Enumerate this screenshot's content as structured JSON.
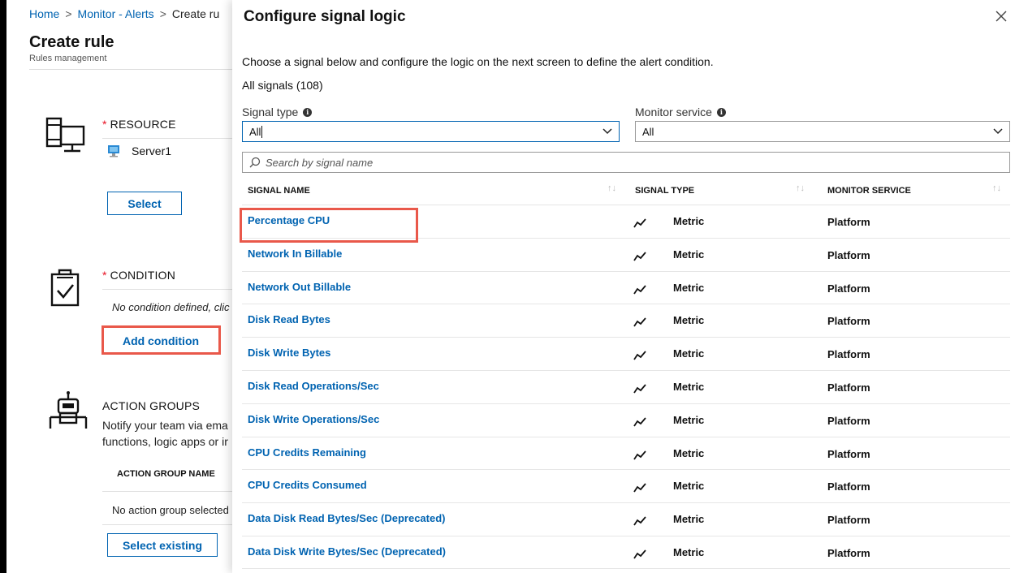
{
  "breadcrumb": {
    "home": "Home",
    "alerts": "Monitor - Alerts",
    "current": "Create ru"
  },
  "left": {
    "title": "Create rule",
    "subtitle": "Rules management",
    "resource": {
      "title": "RESOURCE",
      "required_marker": "*",
      "server_name": "Server1",
      "select_button": "Select"
    },
    "condition": {
      "title": "CONDITION",
      "required_marker": "*",
      "empty_text": "No condition defined, clic",
      "add_button": "Add condition"
    },
    "action_groups": {
      "title": "ACTION GROUPS",
      "desc_line1": "Notify your team via ema",
      "desc_line2": "functions, logic apps or ir",
      "column_header": "ACTION GROUP NAME",
      "empty_text": "No action group selected",
      "select_button": "Select existing"
    }
  },
  "panel": {
    "title": "Configure signal logic",
    "close_label": "×",
    "instruction": "Choose a signal below and configure the logic on the next screen to define the alert condition.",
    "all_signals": "All signals (108)",
    "signal_type": {
      "label": "Signal type",
      "value": "All"
    },
    "monitor_service": {
      "label": "Monitor service",
      "value": "All"
    },
    "search": {
      "placeholder": "Search by signal name"
    },
    "columns": {
      "signal_name": "SIGNAL NAME",
      "signal_type": "SIGNAL TYPE",
      "monitor_service": "MONITOR SERVICE",
      "sort_glyph": "↑↓"
    },
    "signals": [
      {
        "name": "Percentage CPU",
        "type": "Metric",
        "service": "Platform"
      },
      {
        "name": "Network In Billable",
        "type": "Metric",
        "service": "Platform"
      },
      {
        "name": "Network Out Billable",
        "type": "Metric",
        "service": "Platform"
      },
      {
        "name": "Disk Read Bytes",
        "type": "Metric",
        "service": "Platform"
      },
      {
        "name": "Disk Write Bytes",
        "type": "Metric",
        "service": "Platform"
      },
      {
        "name": "Disk Read Operations/Sec",
        "type": "Metric",
        "service": "Platform"
      },
      {
        "name": "Disk Write Operations/Sec",
        "type": "Metric",
        "service": "Platform"
      },
      {
        "name": "CPU Credits Remaining",
        "type": "Metric",
        "service": "Platform"
      },
      {
        "name": "CPU Credits Consumed",
        "type": "Metric",
        "service": "Platform"
      },
      {
        "name": "Data Disk Read Bytes/Sec (Deprecated)",
        "type": "Metric",
        "service": "Platform"
      },
      {
        "name": "Data Disk Write Bytes/Sec (Deprecated)",
        "type": "Metric",
        "service": "Platform"
      }
    ]
  },
  "colors": {
    "link_blue": "#0063b1",
    "highlight_red": "#e9584a",
    "required_red": "#e81123"
  }
}
